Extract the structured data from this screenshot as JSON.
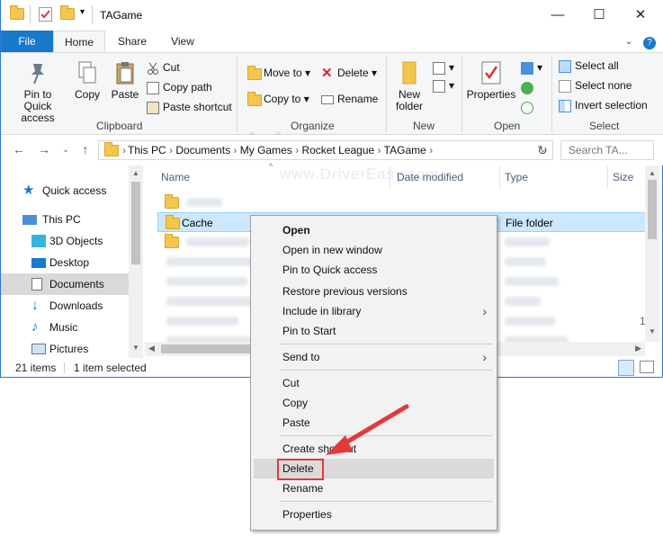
{
  "window": {
    "title": "TAGame",
    "minimize": "—",
    "maximize": "☐",
    "close": "✕"
  },
  "tabs": {
    "file": "File",
    "home": "Home",
    "share": "Share",
    "view": "View"
  },
  "ribbon": {
    "clipboard": {
      "label": "Clipboard",
      "pin": "Pin to Quick access",
      "copy": "Copy",
      "paste": "Paste",
      "cut": "Cut",
      "copy_path": "Copy path",
      "paste_shortcut": "Paste shortcut"
    },
    "organize": {
      "label": "Organize",
      "move_to": "Move to",
      "copy_to": "Copy to",
      "delete": "Delete",
      "rename": "Rename"
    },
    "new": {
      "label": "New",
      "new_folder": "New folder"
    },
    "open": {
      "label": "Open",
      "properties": "Properties"
    },
    "select": {
      "label": "Select",
      "select_all": "Select all",
      "select_none": "Select none",
      "invert": "Invert selection"
    }
  },
  "address": {
    "path": [
      "This PC",
      "Documents",
      "My Games",
      "Rocket League",
      "TAGame"
    ],
    "search_placeholder": "Search TA..."
  },
  "nav": {
    "items": [
      {
        "label": "Quick access"
      },
      {
        "label": "This PC"
      },
      {
        "label": "3D Objects"
      },
      {
        "label": "Desktop"
      },
      {
        "label": "Documents"
      },
      {
        "label": "Downloads"
      },
      {
        "label": "Music"
      },
      {
        "label": "Pictures"
      }
    ]
  },
  "list": {
    "columns": {
      "name": "Name",
      "date": "Date modified",
      "type": "Type",
      "size": "Size"
    },
    "selected_row": {
      "name": "Cache",
      "type": "File folder"
    }
  },
  "status": {
    "count": "21 items",
    "selected": "1 item selected"
  },
  "context_menu": {
    "open": "Open",
    "open_new_window": "Open in new window",
    "pin_quick": "Pin to Quick access",
    "restore": "Restore previous versions",
    "include_library": "Include in library",
    "pin_start": "Pin to Start",
    "send_to": "Send to",
    "cut": "Cut",
    "copy": "Copy",
    "paste": "Paste",
    "create_shortcut": "Create shortcut",
    "delete": "Delete",
    "rename": "Rename",
    "properties": "Properties"
  },
  "watermark": {
    "brand": "driver easy",
    "url": "www.DriverEasy.com"
  },
  "colors": {
    "accent": "#1979ca",
    "highlight_red": "#e5383b",
    "selection": "#cce8ff"
  }
}
